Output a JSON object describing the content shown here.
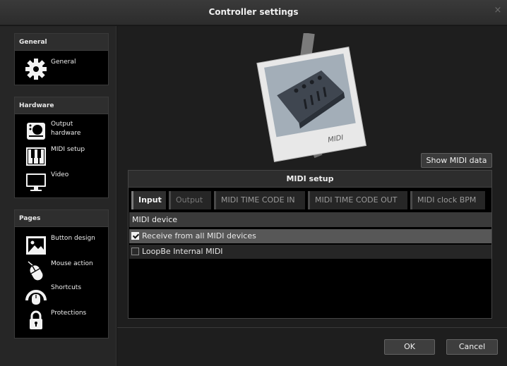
{
  "window": {
    "title": "Controller settings",
    "close_glyph": "×"
  },
  "sidebar": {
    "general": {
      "heading": "General",
      "items": [
        {
          "label": "General",
          "icon": "gear-icon"
        }
      ]
    },
    "hardware": {
      "heading": "Hardware",
      "items": [
        {
          "label": "Output\nhardware",
          "icon": "output-hardware-icon"
        },
        {
          "label": "MIDI setup",
          "icon": "piano-keys-icon"
        },
        {
          "label": "Video",
          "icon": "monitor-icon"
        }
      ]
    },
    "pages": {
      "heading": "Pages",
      "items": [
        {
          "label": "Button design",
          "icon": "image-icon"
        },
        {
          "label": "Mouse action",
          "icon": "mouse-icon"
        },
        {
          "label": "Shortcuts",
          "icon": "shortcuts-icon"
        },
        {
          "label": "Protections",
          "icon": "lock-icon"
        }
      ]
    }
  },
  "preview": {
    "caption": "MIDI"
  },
  "show_midi_label": "Show MIDI data",
  "midi_setup": {
    "heading": "MIDI setup",
    "tabs": [
      {
        "label": "Input",
        "active": true
      },
      {
        "label": "Output",
        "active": false
      },
      {
        "label": "MIDI TIME CODE IN",
        "active": false
      },
      {
        "label": "MIDI TIME CODE OUT",
        "active": false
      },
      {
        "label": "MIDI clock BPM",
        "active": false
      }
    ],
    "column_header": "MIDI device",
    "devices": [
      {
        "label": "Receive from all MIDI devices",
        "checked": true
      },
      {
        "label": "LoopBe Internal MIDI",
        "checked": false
      }
    ]
  },
  "footer": {
    "ok_label": "OK",
    "cancel_label": "Cancel"
  },
  "colors": {
    "panel_bg": "#000000",
    "window_bg": "#1e1e1e",
    "selected_row": "#575757"
  }
}
